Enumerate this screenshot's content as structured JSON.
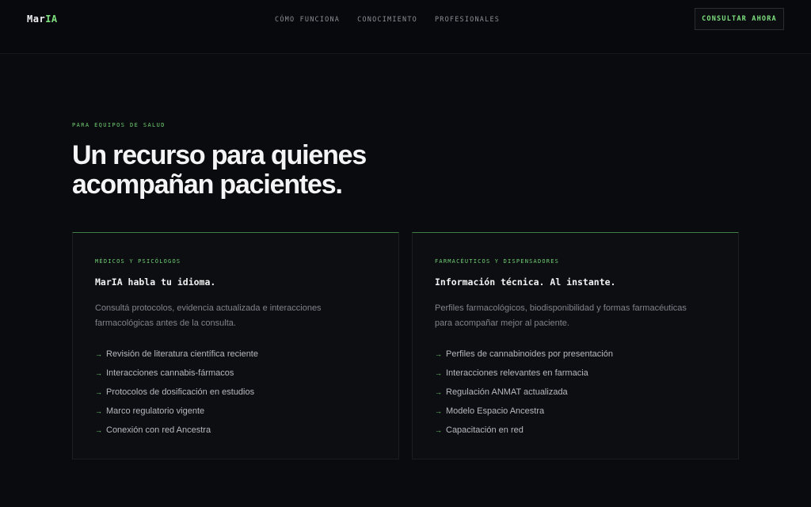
{
  "header": {
    "logo_main": "Mar",
    "logo_accent": "IA",
    "nav": [
      "CÓMO FUNCIONA",
      "CONOCIMIENTO",
      "PROFESIONALES"
    ],
    "cta_label": "CONSULTAR AHORA"
  },
  "hero": {
    "eyebrow": "PARA EQUIPOS DE SALUD",
    "title_line1": "Un recurso para quienes",
    "title_line2": "acompañan pacientes."
  },
  "cards": [
    {
      "tag": "MÉDICOS Y PSICÓLOGOS",
      "heading": "MarIA habla tu idioma.",
      "description": "Consultá protocolos, evidencia actualizada e interacciones farmacológicas antes de la consulta.",
      "items": [
        "Revisión de literatura científica reciente",
        "Interacciones cannabis-fármacos",
        "Protocolos de dosificación en estudios",
        "Marco regulatorio vigente",
        "Conexión con red Ancestra"
      ]
    },
    {
      "tag": "FARMACÉUTICOS Y DISPENSADORES",
      "heading": "Información técnica. Al instante.",
      "description": "Perfiles farmacológicos, biodisponibilidad y formas farmacéuticas para acompañar mejor al paciente.",
      "items": [
        "Perfiles de cannabinoides por presentación",
        "Interacciones relevantes en farmacia",
        "Regulación ANMAT actualizada",
        "Modelo Espacio Ancestra",
        "Capacitación en red"
      ]
    }
  ],
  "icons": {
    "list_bullet": "arrow-right-icon"
  },
  "colors": {
    "accent": "#6fcf73",
    "background": "#0a0b0e",
    "card": "#0d0e12"
  }
}
